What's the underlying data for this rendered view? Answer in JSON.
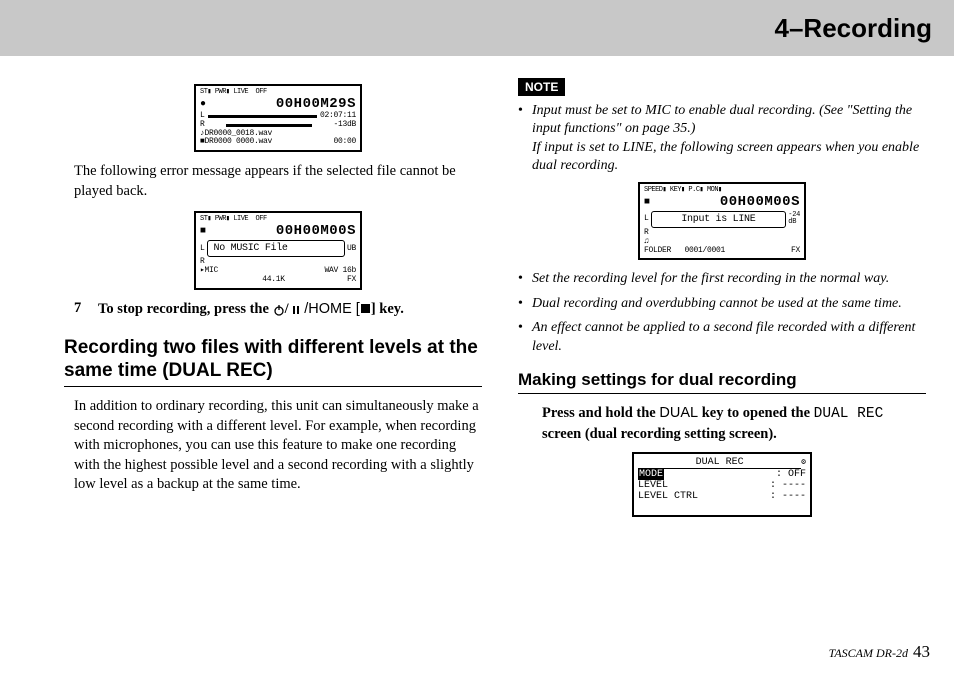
{
  "header": {
    "title": "4–Recording"
  },
  "left": {
    "lcd1": {
      "top_icons": "ST▮ PWR▮ LIVE  OFF",
      "time": "00H00M29S",
      "elapsed": "02:07:11",
      "db": "-13dB",
      "file_a": "DR0000_0018.wav",
      "file_b": "DR0000 0000.wav",
      "pos": "00:00"
    },
    "para1": "The following error message appears if the selected file cannot be played back.",
    "lcd2": {
      "top_icons": "ST▮ PWR▮ LIVE  OFF",
      "time": "00H00M00S",
      "popup": "No MUSIC File",
      "fmt": "WAV 16b",
      "rate": "44.1K",
      "mic": "MIC"
    },
    "step7": {
      "num": "7",
      "text_a": "To stop recording, press the ",
      "home": " /HOME [",
      "text_b": "] key."
    },
    "h2": "Recording two files with different levels at the same time (DUAL REC)",
    "para2": "In addition to ordinary recording, this unit can simultaneously make a second recording with a different level. For example, when recording with microphones, you can use this feature to make one recording with the highest possible level and a second recording with a slightly low level as a backup at the same time."
  },
  "right": {
    "note_label": "NOTE",
    "note1a": "Input must be set to MIC to enable dual recording. (See \"Setting the input functions\" on page 35.)",
    "note1b": "If input is set to LINE, the following screen appears when you enable dual recording.",
    "lcd3": {
      "top_icons": "SPEED▮ KEY▮ P.C▮ MON▮",
      "time": "00H00M00S",
      "popup": "Input is LINE",
      "folder": "FOLDER   0001/0001"
    },
    "note2": "Set the recording level for the first recording in the normal way.",
    "note3": "Dual recording and overdubbing cannot be used at the same time.",
    "note4": "An effect cannot be applied to a second file recorded with a different level.",
    "h3": "Making settings for dual recording",
    "instr_a": "Press and hold the ",
    "instr_dual": "DUAL",
    "instr_b": " key to opened the ",
    "instr_screen": "DUAL REC",
    "instr_c": " screen (dual recording setting screen).",
    "lcd4": {
      "title": "DUAL REC",
      "r1k": "MODE",
      "r1v": ": OFF",
      "r2k": "LEVEL",
      "r2v": ": ----",
      "r3k": "LEVEL CTRL",
      "r3v": ": ----"
    }
  },
  "footer": {
    "product": "TASCAM  DR-2d ",
    "page": "43"
  }
}
